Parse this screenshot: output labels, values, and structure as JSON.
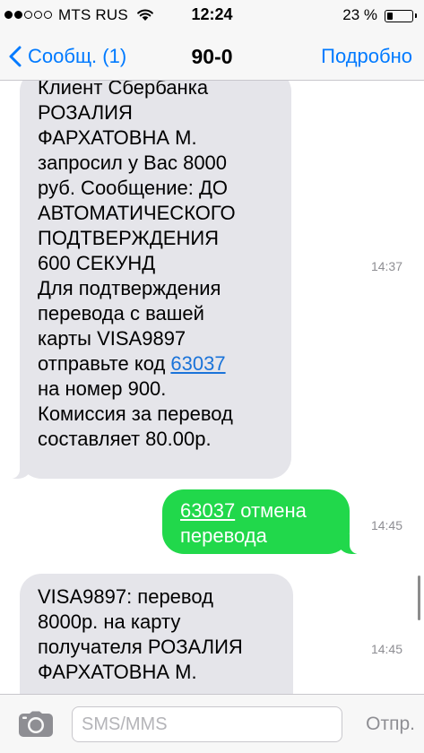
{
  "status_bar": {
    "signal_dots_filled": 2,
    "signal_dots_total": 5,
    "carrier": "MTS RUS",
    "time": "12:24",
    "battery_text": "23 %",
    "battery_level": 0.23
  },
  "nav": {
    "back_label": "Сообщ. (1)",
    "title": "90-0",
    "details_label": "Подробно"
  },
  "messages": [
    {
      "direction": "incoming",
      "lines": [
        "Клиент Сбербанка",
        "РОЗАЛИЯ",
        "ФАРХАТОВНА М.",
        "запросил у Вас 8000",
        "руб. Сообщение: ДО",
        "АВТОМАТИЧЕСКОГО",
        "ПОДТВЕРЖДЕНИЯ",
        "600 СЕКУНД",
        "Для подтверждения",
        "перевода с вашей",
        "карты VISA9897",
        "отправьте код ",
        "63037",
        "на номер 900.",
        "Комиссия за перевод",
        "составляет 80.00р."
      ],
      "time": "14:37"
    },
    {
      "direction": "outgoing",
      "code": "63037",
      "line1_rest": " отмена",
      "line2": "перевода",
      "time": "14:45"
    },
    {
      "direction": "incoming",
      "lines": [
        "VISA9897: перевод",
        "8000р. на карту",
        "получателя РОЗАЛИЯ",
        "ФАРХАТОВНА М."
      ],
      "time": "14:45"
    }
  ],
  "input_bar": {
    "placeholder": "SMS/MMS",
    "send_label": "Отпр."
  },
  "colors": {
    "accent": "#007aff",
    "incoming_bubble": "#e5e5ea",
    "outgoing_bubble": "#21d84b",
    "link": "#1a73d9",
    "timestamp": "#8e8e93"
  },
  "icons": [
    "back-chevron-icon",
    "wifi-icon",
    "camera-icon"
  ]
}
